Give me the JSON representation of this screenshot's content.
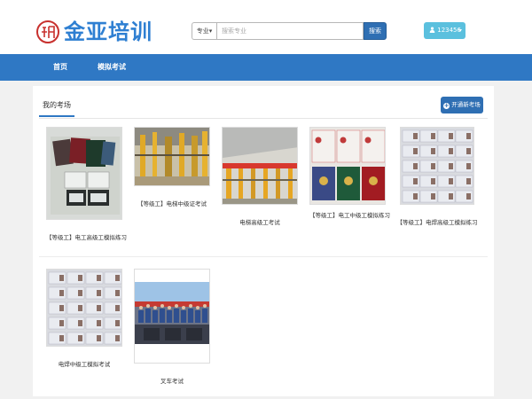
{
  "header": {
    "logo_text": "金亚培训",
    "search": {
      "category_label": "专业",
      "placeholder": "搜索专业",
      "button_label": "搜索"
    },
    "user": {
      "username": "123456"
    }
  },
  "nav": {
    "items": [
      {
        "label": "首页"
      },
      {
        "label": "模拟考试"
      }
    ]
  },
  "main": {
    "tab_label": "我的考场",
    "add_button_label": "开通新考场",
    "exams": [
      {
        "title": "【等级工】电工高级工模拟练习",
        "thumb": "certificates-photo"
      },
      {
        "title": "【等级工】电梯中级证考试",
        "thumb": "workshop-photo"
      },
      {
        "title": "电梯高级工考试",
        "thumb": "factory-photo"
      },
      {
        "title": "【等级工】电工中级工模拟练习",
        "thumb": "certificate-pages"
      },
      {
        "title": "【等级工】电焊高级工模拟练习",
        "thumb": "id-cards"
      },
      {
        "title": "电焊中级工模拟考试",
        "thumb": "id-cards"
      },
      {
        "title": "叉车考试",
        "thumb": "group-photo"
      }
    ]
  },
  "colors": {
    "nav_bg": "#2f78c4",
    "brand_blue": "#2e7fd2",
    "user_button": "#5bc0de",
    "logo_red": "#c8312e"
  }
}
